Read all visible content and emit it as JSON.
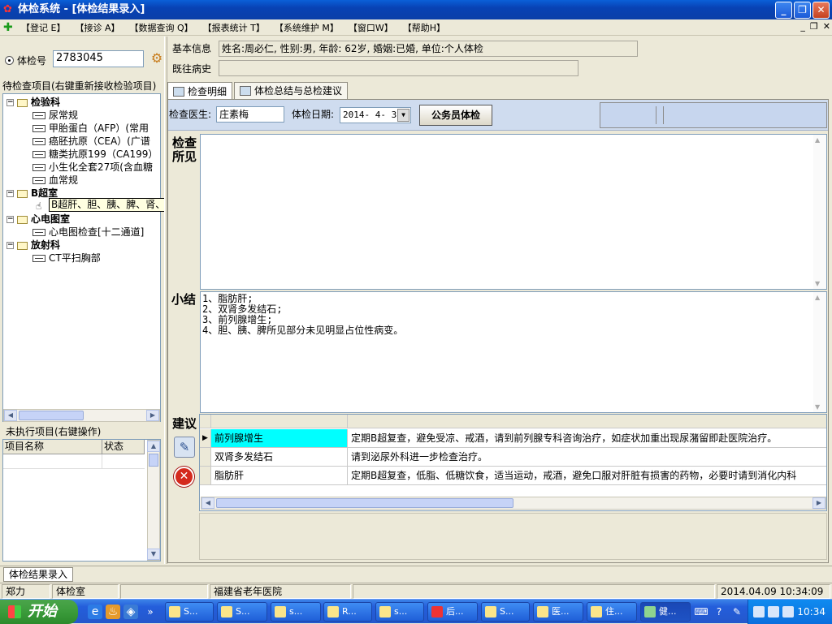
{
  "window": {
    "title": "体检系统 - [体检结果录入]"
  },
  "menu": [
    "【登记 E】",
    "【接诊 A】",
    "【数据查询 Q】",
    "【报表统计 T】",
    "【系统维护 M】",
    "【窗口W】",
    "【帮助H】"
  ],
  "search": {
    "radio_label": "体检号",
    "exam_no": "2783045"
  },
  "info": {
    "basic_label": "基本信息",
    "basic_value": "姓名:周必仁, 性别:男, 年龄: 62岁, 婚姻:已婚, 单位:个人体检",
    "history_label": "既往病史",
    "history_value": ""
  },
  "pending": {
    "header": "待检查项目(右键重新接收检验项目)",
    "tree": [
      {
        "label": "检验科",
        "level": 0,
        "kind": "folder",
        "bold": true
      },
      {
        "label": "尿常规",
        "level": 1,
        "kind": "leaf"
      },
      {
        "label": "甲胎蛋白（AFP）(常用",
        "level": 1,
        "kind": "leaf"
      },
      {
        "label": "癌胚抗原（CEA）(广谱",
        "level": 1,
        "kind": "leaf"
      },
      {
        "label": "糖类抗原199（CA199）",
        "level": 1,
        "kind": "leaf"
      },
      {
        "label": "小生化全套27项(含血糖",
        "level": 1,
        "kind": "leaf"
      },
      {
        "label": "血常规",
        "level": 1,
        "kind": "leaf"
      },
      {
        "label": "B超室",
        "level": 0,
        "kind": "folder",
        "bold": true
      },
      {
        "label": "",
        "level": 1,
        "kind": "leaf"
      },
      {
        "label": "心电图室",
        "level": 0,
        "kind": "folder",
        "bold": true
      },
      {
        "label": "心电图检查[十二通道]",
        "level": 1,
        "kind": "leaf"
      },
      {
        "label": "放射科",
        "level": 0,
        "kind": "folder",
        "bold": true
      },
      {
        "label": "CT平扫胸部",
        "level": 1,
        "kind": "leaf"
      }
    ],
    "tooltip": "B超肝、胆、胰、脾、肾、前列腺"
  },
  "unexecuted": {
    "header": "未执行项目(右键操作)",
    "col_name": "项目名称",
    "col_status": "状态"
  },
  "tabs": [
    {
      "label": "检查明细",
      "active": true
    },
    {
      "label": "体检总结与总检建议",
      "active": false
    }
  ],
  "exam": {
    "doctor_label": "检查医生:",
    "doctor": "庄素梅",
    "date_label": "体检日期:",
    "date": "2014- 4- 3",
    "civil_btn": "公务员体检"
  },
  "findings": {
    "label_line1": "检查",
    "label_line2": "所见",
    "text": ""
  },
  "summary": {
    "label": "小结",
    "lines": [
      "1、脂肪肝;",
      "2、双肾多发结石;",
      "3、前列腺增生;",
      "4、胆、胰、脾所见部分未见明显占位性病变。"
    ]
  },
  "advice": {
    "label": "建议",
    "rows": [
      {
        "name": "前列腺增生",
        "text": "定期B超复查，避免受凉、戒酒，请到前列腺专科咨询治疗，如症状加重出现尿潴留即赴医院治疗。",
        "selected": true
      },
      {
        "name": "双肾多发结石",
        "text": "请到泌尿外科进一步检查治疗。",
        "selected": false
      },
      {
        "name": "脂肪肝",
        "text": "定期B超复查，低脂、低糖饮食，适当运动，戒酒，避免口服对肝脏有损害的药物，必要时请到消化内科",
        "selected": false
      }
    ]
  },
  "bottom_tab": "体检结果录入",
  "status": {
    "user": "郑力",
    "dept": "体检室",
    "hospital": "福建省老年医院",
    "datetime": "2014.04.09 10:34:09"
  },
  "taskbar": {
    "start": "开始",
    "buttons": [
      "S...",
      "S...",
      "s...",
      "R...",
      "s...",
      "后...",
      "S...",
      "医...",
      "住...",
      "健..."
    ],
    "clock": "10:34"
  },
  "colors": {
    "title_blue": "#0842b4",
    "selected_cell": "#00ffff",
    "band_blue": "#cfdcef",
    "close_red": "#c6421f"
  }
}
